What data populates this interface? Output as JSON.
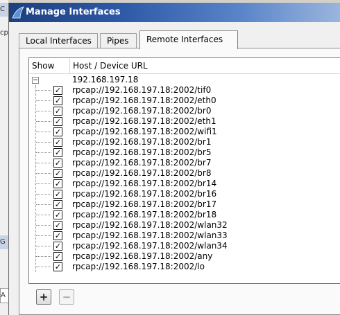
{
  "background": {
    "fragments": [
      "C",
      "cp",
      "G",
      "A"
    ]
  },
  "dialog": {
    "title": "Manage Interfaces",
    "tabs": [
      {
        "label": "Local Interfaces",
        "active": false
      },
      {
        "label": "Pipes",
        "active": false
      },
      {
        "label": "Remote Interfaces",
        "active": true
      }
    ],
    "columns": {
      "show": "Show",
      "host": "Host / Device URL"
    },
    "host": {
      "name": "192.168.197.18",
      "expanded": true,
      "expander_symbol": "−"
    },
    "interfaces": [
      {
        "url": "rpcap://192.168.197.18:2002/tif0",
        "checked": true
      },
      {
        "url": "rpcap://192.168.197.18:2002/eth0",
        "checked": true
      },
      {
        "url": "rpcap://192.168.197.18:2002/br0",
        "checked": true
      },
      {
        "url": "rpcap://192.168.197.18:2002/eth1",
        "checked": true
      },
      {
        "url": "rpcap://192.168.197.18:2002/wifi1",
        "checked": true
      },
      {
        "url": "rpcap://192.168.197.18:2002/br1",
        "checked": true
      },
      {
        "url": "rpcap://192.168.197.18:2002/br5",
        "checked": true
      },
      {
        "url": "rpcap://192.168.197.18:2002/br7",
        "checked": true
      },
      {
        "url": "rpcap://192.168.197.18:2002/br8",
        "checked": true
      },
      {
        "url": "rpcap://192.168.197.18:2002/br14",
        "checked": true
      },
      {
        "url": "rpcap://192.168.197.18:2002/br16",
        "checked": true
      },
      {
        "url": "rpcap://192.168.197.18:2002/br17",
        "checked": true
      },
      {
        "url": "rpcap://192.168.197.18:2002/br18",
        "checked": true
      },
      {
        "url": "rpcap://192.168.197.18:2002/wlan32",
        "checked": true
      },
      {
        "url": "rpcap://192.168.197.18:2002/wlan33",
        "checked": true
      },
      {
        "url": "rpcap://192.168.197.18:2002/wlan34",
        "checked": true
      },
      {
        "url": "rpcap://192.168.197.18:2002/any",
        "checked": true
      },
      {
        "url": "rpcap://192.168.197.18:2002/lo",
        "checked": true
      }
    ],
    "buttons": {
      "add": "+",
      "remove": "−"
    },
    "checkmark": "✓",
    "colors": {
      "title_start": "#1d3f80",
      "title_end": "#9bb6de"
    }
  }
}
